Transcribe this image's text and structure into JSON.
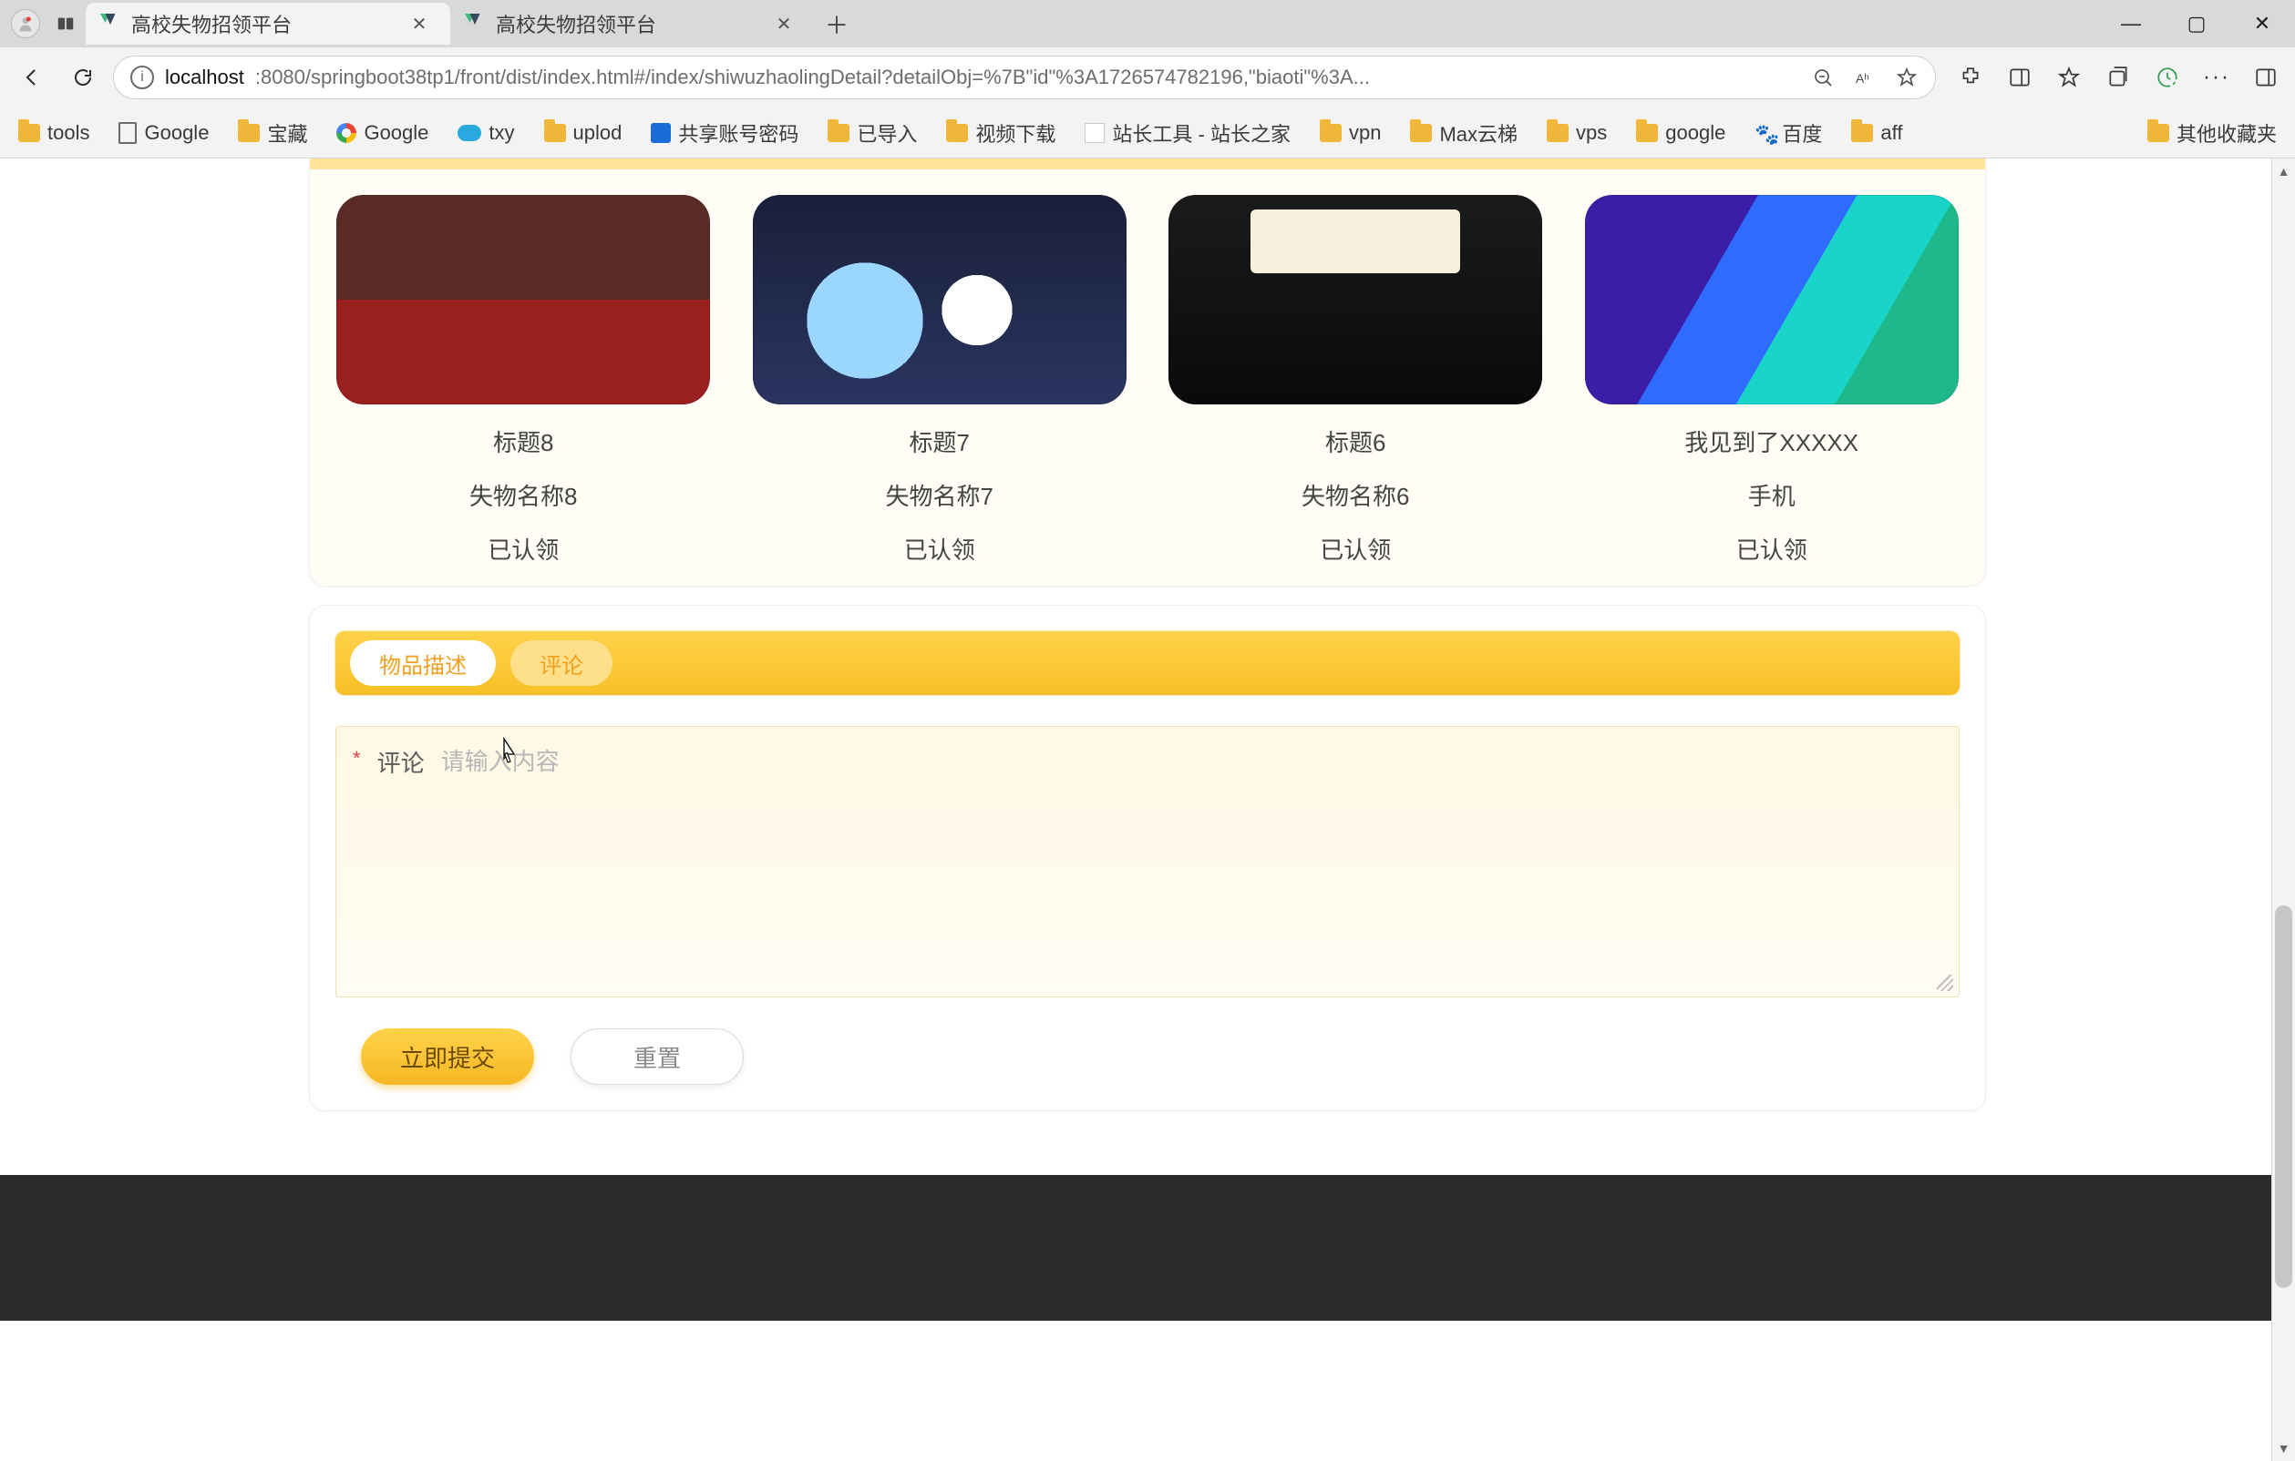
{
  "browser": {
    "tabs": [
      {
        "title": "高校失物招领平台",
        "active": true
      },
      {
        "title": "高校失物招领平台",
        "active": false
      }
    ],
    "url_host": "localhost",
    "url_rest": ":8080/springboot38tp1/front/dist/index.html#/index/shiwuzhaolingDetail?detailObj=%7B\"id\"%3A1726574782196,\"biaoti\"%3A...",
    "bookmarks": [
      {
        "label": "tools",
        "icon": "folder"
      },
      {
        "label": "Google",
        "icon": "page"
      },
      {
        "label": "宝藏",
        "icon": "folder"
      },
      {
        "label": "Google",
        "icon": "google"
      },
      {
        "label": "txy",
        "icon": "cloud"
      },
      {
        "label": "uplod",
        "icon": "folder"
      },
      {
        "label": "共享账号密码",
        "icon": "key"
      },
      {
        "label": "已导入",
        "icon": "folder"
      },
      {
        "label": "视频下载",
        "icon": "folder"
      },
      {
        "label": "站长工具 - 站长之家",
        "icon": "zz"
      },
      {
        "label": "vpn",
        "icon": "folder"
      },
      {
        "label": "Max云梯",
        "icon": "folder"
      },
      {
        "label": "vps",
        "icon": "folder"
      },
      {
        "label": "google",
        "icon": "folder"
      },
      {
        "label": "百度",
        "icon": "paw"
      },
      {
        "label": "aff",
        "icon": "folder"
      }
    ],
    "overflow_bookmark": "其他收藏夹"
  },
  "items": [
    {
      "title": "标题8",
      "name": "失物名称8",
      "status": "已认领"
    },
    {
      "title": "标题7",
      "name": "失物名称7",
      "status": "已认领"
    },
    {
      "title": "标题6",
      "name": "失物名称6",
      "status": "已认领"
    },
    {
      "title": "我见到了XXXXX",
      "name": "手机",
      "status": "已认领"
    }
  ],
  "tabs": {
    "desc": "物品描述",
    "comment": "评论"
  },
  "form": {
    "label": "评论",
    "placeholder": "请输入内容",
    "submit": "立即提交",
    "reset": "重置"
  }
}
